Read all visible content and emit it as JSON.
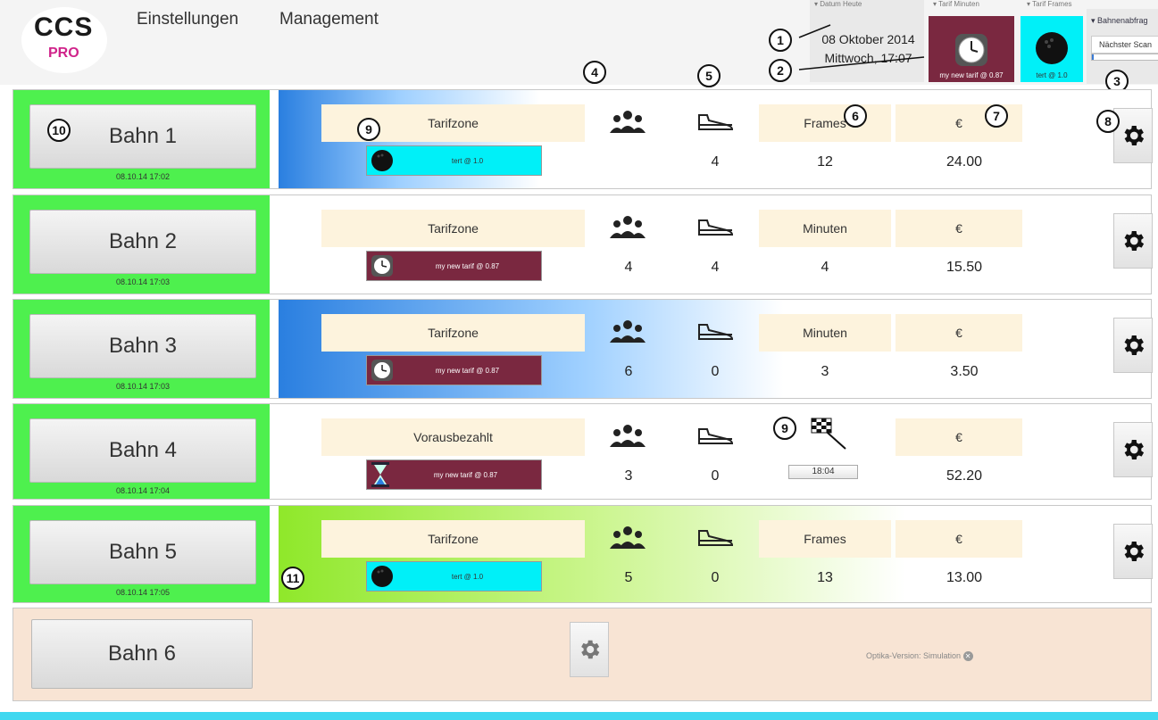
{
  "logo": {
    "ccs": "CCS",
    "pro": "PRO"
  },
  "menu": [
    "Einstellungen",
    "Management"
  ],
  "header": {
    "datum_label": "▾ Datum Heute",
    "date": "08 Oktober 2014",
    "time": "Mittwoch, 17:07",
    "tarif_minuten_label": "▾ Tarif Minuten",
    "tarif_minuten_name": "my new tarif @ 0.87",
    "tarif_frames_label": "▾ Tarif Frames",
    "tarif_frames_name": "tert @ 1.0",
    "bahnenabfrage_label": "▾ Bahnenabfrag",
    "naechster_scan": "Nächster Scan"
  },
  "callouts": [
    "1",
    "2",
    "3",
    "4",
    "5",
    "6",
    "7",
    "8",
    "9",
    "10",
    "11"
  ],
  "lanes": [
    {
      "name": "Bahn 1",
      "time": "08.10.14 17:02",
      "zone": "Tarifzone",
      "tarif": "tert @ 1.0",
      "tarif_kind": "frames",
      "players": "",
      "shoes": "4",
      "unit_label": "Frames",
      "unit_value": "12",
      "currency": "€",
      "amount": "24.00"
    },
    {
      "name": "Bahn 2",
      "time": "08.10.14 17:03",
      "zone": "Tarifzone",
      "tarif": "my new tarif @ 0.87",
      "tarif_kind": "minuten",
      "players": "4",
      "shoes": "4",
      "unit_label": "Minuten",
      "unit_value": "4",
      "currency": "€",
      "amount": "15.50"
    },
    {
      "name": "Bahn 3",
      "time": "08.10.14 17:03",
      "zone": "Tarifzone",
      "tarif": "my new tarif @ 0.87",
      "tarif_kind": "minuten",
      "players": "6",
      "shoes": "0",
      "unit_label": "Minuten",
      "unit_value": "3",
      "currency": "€",
      "amount": "3.50"
    },
    {
      "name": "Bahn 4",
      "time": "08.10.14 17:04",
      "zone": "Vorausbezahlt",
      "tarif": "my new tarif @ 0.87",
      "tarif_kind": "prepaid",
      "players": "3",
      "shoes": "0",
      "unit_label": "",
      "unit_value": "18:04",
      "currency": "€",
      "amount": "52.20"
    },
    {
      "name": "Bahn 5",
      "time": "08.10.14 17:05",
      "zone": "Tarifzone",
      "tarif": "tert @ 1.0",
      "tarif_kind": "frames",
      "players": "5",
      "shoes": "0",
      "unit_label": "Frames",
      "unit_value": "13",
      "currency": "€",
      "amount": "13.00"
    }
  ],
  "lane6": {
    "name": "Bahn 6",
    "optika": "Optika-Version: Simulation"
  },
  "colors": {
    "lane_green": "#4ef04e",
    "zone_bg": "#fdf3dd",
    "maroon": "#7a2840",
    "cyan": "#00f0f8",
    "footer": "#3fd8f0"
  }
}
